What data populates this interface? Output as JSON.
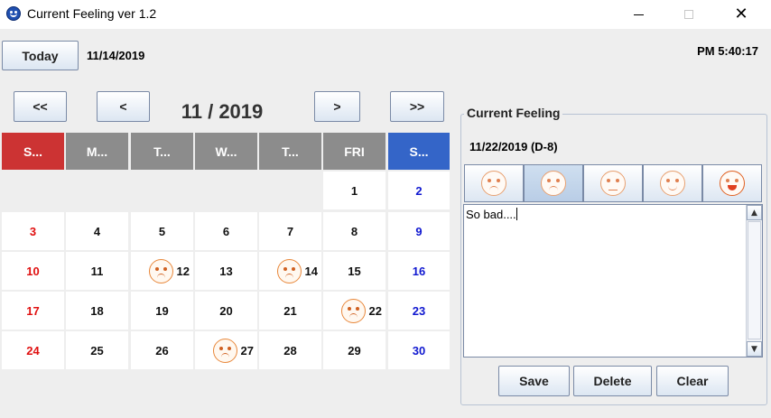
{
  "window": {
    "title": "Current Feeling ver 1.2"
  },
  "header": {
    "today_label": "Today",
    "today_date": "11/14/2019",
    "clock": "PM  5:40:17"
  },
  "nav": {
    "prev_year": "<<",
    "prev_month": "<",
    "next_month": ">",
    "next_year": ">>",
    "month_label": "11 / 2019"
  },
  "calendar": {
    "weekdays": [
      "S...",
      "M...",
      "T...",
      "W...",
      "T...",
      "FRI",
      "S..."
    ],
    "weekday_colors": [
      "#cc3333",
      "#8c8c8c",
      "#8c8c8c",
      "#8c8c8c",
      "#8c8c8c",
      "#8c8c8c",
      "#3465c8"
    ],
    "weeks": [
      [
        "",
        "",
        "",
        "",
        "",
        "1",
        "2"
      ],
      [
        "3",
        "4",
        "5",
        "6",
        "7",
        "8",
        "9"
      ],
      [
        "10",
        "11",
        "12",
        "13",
        "14",
        "15",
        "16"
      ],
      [
        "17",
        "18",
        "19",
        "20",
        "21",
        "22",
        "23"
      ],
      [
        "24",
        "25",
        "26",
        "27",
        "28",
        "29",
        "30"
      ]
    ],
    "feeling_days": [
      "12",
      "14",
      "22",
      "27"
    ]
  },
  "feeling_panel": {
    "legend": "Current Feeling",
    "selected_date": "11/22/2019 (D-8)",
    "moods": [
      "very-sad-face-icon",
      "sad-face-icon",
      "neutral-face-icon",
      "smile-face-icon",
      "happy-face-icon"
    ],
    "selected_mood_index": 1,
    "note_text": "So bad....",
    "save_label": "Save",
    "delete_label": "Delete",
    "clear_label": "Clear"
  }
}
